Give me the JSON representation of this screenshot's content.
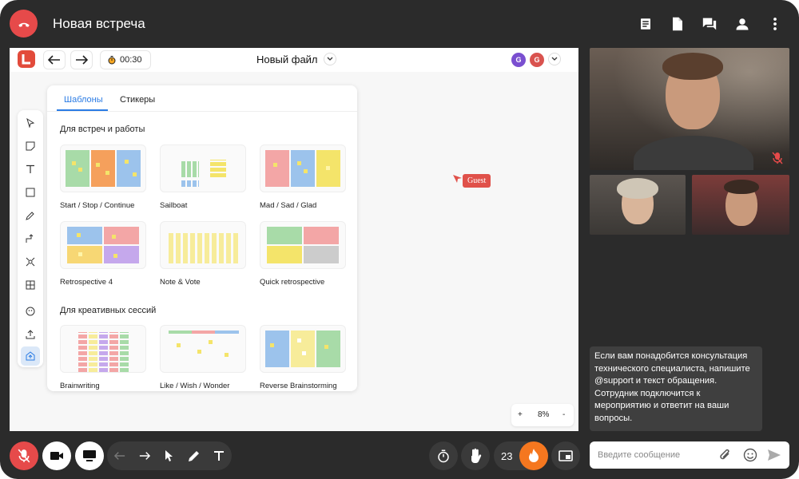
{
  "header": {
    "title": "Новая встреча",
    "icons": [
      "end-call-icon",
      "notes-icon",
      "document-icon",
      "chat-icon",
      "user-icon",
      "more-icon"
    ]
  },
  "board": {
    "timer": "00:30",
    "file_name": "Новый файл",
    "avatars": [
      {
        "initial": "G",
        "color": "#7a4fd0"
      },
      {
        "initial": "G",
        "color": "#d9534f"
      }
    ],
    "cursor_label": "Guest",
    "zoom": {
      "minus": "-",
      "plus": "+",
      "value": "8%"
    }
  },
  "templates_panel": {
    "tabs": [
      {
        "label": "Шаблоны",
        "active": true
      },
      {
        "label": "Стикеры",
        "active": false
      }
    ],
    "sections": [
      {
        "title": "Для встреч и работы",
        "items": [
          "Start / Stop / Continue",
          "Sailboat",
          "Mad / Sad / Glad",
          "Retrospective 4",
          "Note & Vote",
          "Quick retrospective"
        ]
      },
      {
        "title": "Для креативных сессий",
        "items": [
          "Brainwriting",
          "Like / Wish / Wonder",
          "Reverse Brainstorming"
        ]
      }
    ]
  },
  "chat": {
    "message": "Если вам понадобится консультация технического специалиста, напишите @support и текст обращения. Сотрудник подключится к мероприятию и ответит на ваши вопросы.",
    "placeholder": "Введите сообщение"
  },
  "bottom_bar": {
    "reactions_count": "23"
  },
  "colors": {
    "background": "#2b2b2b",
    "danger": "#e64a4a",
    "accent": "#2a7be4",
    "fire": "#f5771f"
  }
}
